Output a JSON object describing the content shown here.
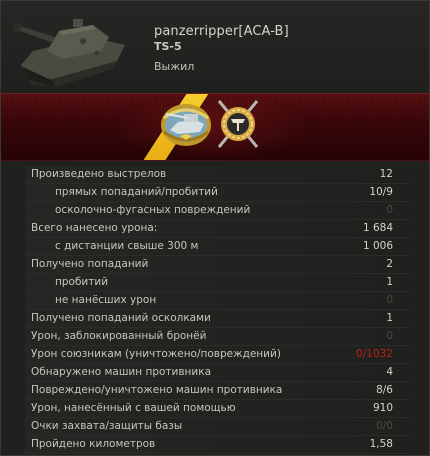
{
  "header": {
    "player": "panzerripper[ACA-B]",
    "vehicle": "TS-5",
    "status": "Выжил"
  },
  "icons": {
    "tank": "tank-icon",
    "medal_left": "tank-medal-icon",
    "medal_right": "crossed-swords-medal-icon"
  },
  "colors": {
    "accent_yellow": "#f0c020",
    "band_red": "#4a0b0e",
    "negative_red": "#b8201a",
    "text": "#c9c5b8"
  },
  "stats": [
    {
      "label": "Произведено выстрелов",
      "value": "12",
      "sub": false,
      "style": "normal"
    },
    {
      "label": "прямых попаданий/пробитий",
      "value": "10/9",
      "sub": true,
      "style": "normal"
    },
    {
      "label": "осколочно-фугасных повреждений",
      "value": "0",
      "sub": true,
      "style": "dim"
    },
    {
      "label": "Всего нанесено урона:",
      "value": "1 684",
      "sub": false,
      "style": "normal"
    },
    {
      "label": "с дистанции свыше 300 м",
      "value": "1 006",
      "sub": true,
      "style": "normal"
    },
    {
      "label": "Получено попаданий",
      "value": "2",
      "sub": false,
      "style": "normal"
    },
    {
      "label": "пробитий",
      "value": "1",
      "sub": true,
      "style": "normal"
    },
    {
      "label": "не нанёсших урон",
      "value": "0",
      "sub": true,
      "style": "dim"
    },
    {
      "label": "Получено попаданий осколками",
      "value": "1",
      "sub": false,
      "style": "normal"
    },
    {
      "label": "Урон, заблокированный бронёй",
      "value": "0",
      "sub": false,
      "style": "dim"
    },
    {
      "label": "Урон союзникам (уничтожено/повреждений)",
      "value": "0/1032",
      "sub": false,
      "style": "red"
    },
    {
      "label": "Обнаружено машин противника",
      "value": "4",
      "sub": false,
      "style": "normal"
    },
    {
      "label": "Повреждено/уничтожено машин противника",
      "value": "8/6",
      "sub": false,
      "style": "normal"
    },
    {
      "label": "Урон, нанесённый с вашей помощью",
      "value": "910",
      "sub": false,
      "style": "normal"
    },
    {
      "label": "Очки захвата/защиты базы",
      "value": "0/0",
      "sub": false,
      "style": "dim"
    },
    {
      "label": "Пройдено километров",
      "value": "1,58",
      "sub": false,
      "style": "normal"
    }
  ]
}
